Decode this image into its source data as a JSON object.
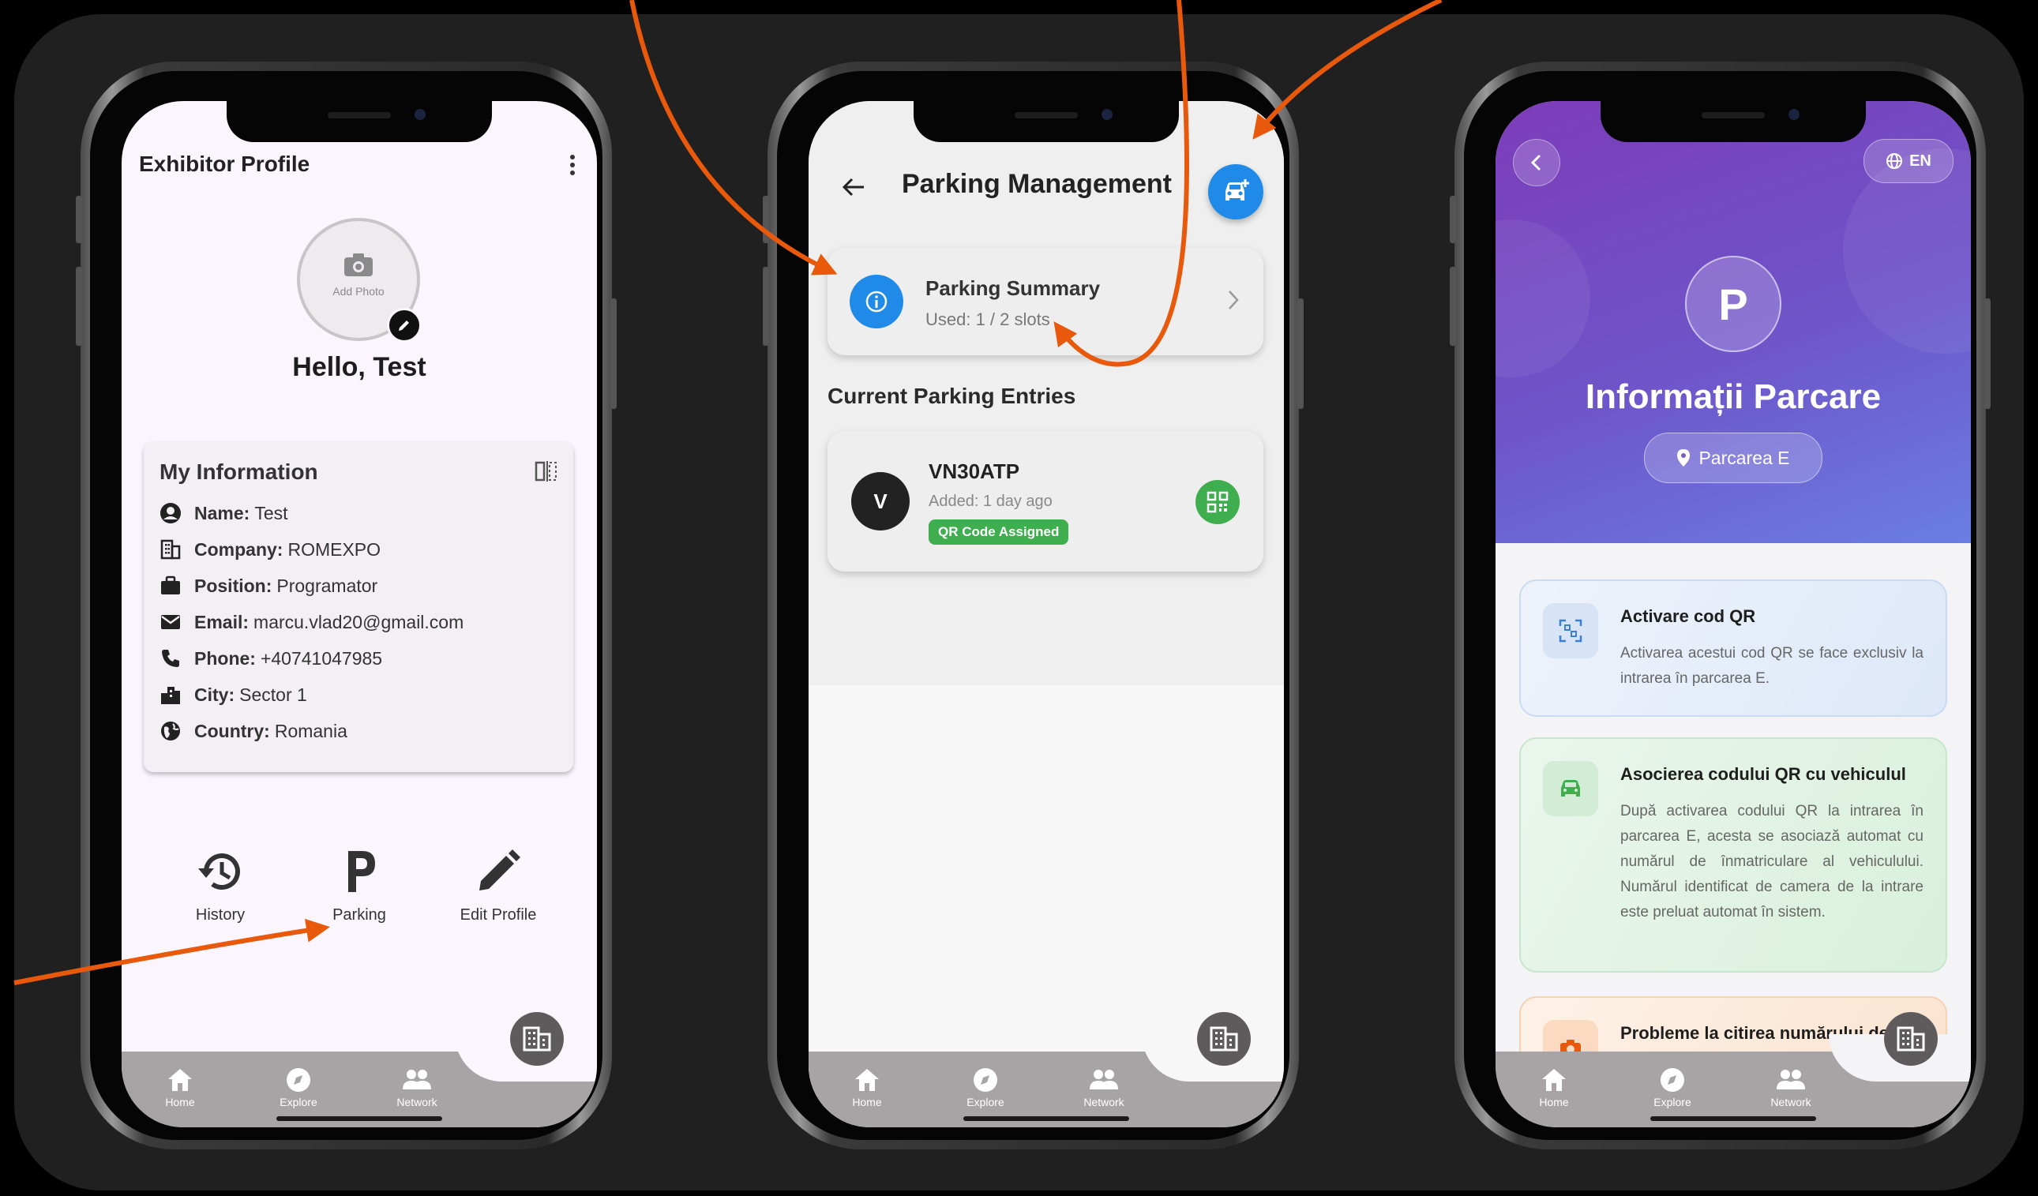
{
  "colors": {
    "accent_orange": "#e8590c",
    "blue": "#1f8ae8",
    "green": "#3fae4f",
    "purple": "#7d3cb9"
  },
  "tabbar": {
    "tabs": [
      {
        "label": "Home",
        "icon": "home-icon"
      },
      {
        "label": "Explore",
        "icon": "explore-icon"
      },
      {
        "label": "Network",
        "icon": "network-icon"
      }
    ],
    "fab_icon": "building-icon"
  },
  "screen1": {
    "title": "Exhibitor Profile",
    "add_photo": "Add Photo",
    "greeting": "Hello, Test",
    "info_title": "My Information",
    "info": [
      {
        "label": "Name:",
        "value": "Test",
        "icon": "account-circle-icon"
      },
      {
        "label": "Company:",
        "value": "ROMEXPO",
        "icon": "building-icon"
      },
      {
        "label": "Position:",
        "value": "Programator",
        "icon": "briefcase-icon"
      },
      {
        "label": "Email:",
        "value": "marcu.vlad20@gmail.com",
        "icon": "mail-icon"
      },
      {
        "label": "Phone:",
        "value": "+40741047985",
        "icon": "phone-icon"
      },
      {
        "label": "City:",
        "value": "Sector 1",
        "icon": "city-icon"
      },
      {
        "label": "Country:",
        "value": "Romania",
        "icon": "globe-icon"
      }
    ],
    "actions": [
      {
        "label": "History",
        "icon": "history-icon"
      },
      {
        "label": "Parking",
        "icon": "parking-icon"
      },
      {
        "label": "Edit Profile",
        "icon": "pencil-icon"
      }
    ]
  },
  "screen2": {
    "title": "Parking Management",
    "summary_title": "Parking Summary",
    "summary_sub": "Used: 1 / 2 slots",
    "section_title": "Current Parking Entries",
    "entry": {
      "avatar_letter": "V",
      "plate": "VN30ATP",
      "added": "Added: 1 day ago",
      "badge": "QR Code Assigned"
    }
  },
  "screen3": {
    "lang": "EN",
    "badge_letter": "P",
    "title": "Informații Parcare",
    "location": "Parcarea E",
    "cards": [
      {
        "title": "Activare cod QR",
        "text": "Activarea acestui cod QR se face exclusiv la intrarea în parcarea E.",
        "icon": "qr-scan-icon"
      },
      {
        "title": "Asocierea codului QR cu vehiculul",
        "text": "După activarea codului QR la intrarea în parcarea E, acesta se asociază automat cu numărul de înmatriculare al vehiculului. Numărul identificat de camera de la intrare este preluat automat în sistem.",
        "icon": "car-icon"
      },
      {
        "title": "Probleme la citirea numărului de",
        "text": "",
        "icon": "camera-icon"
      }
    ]
  }
}
